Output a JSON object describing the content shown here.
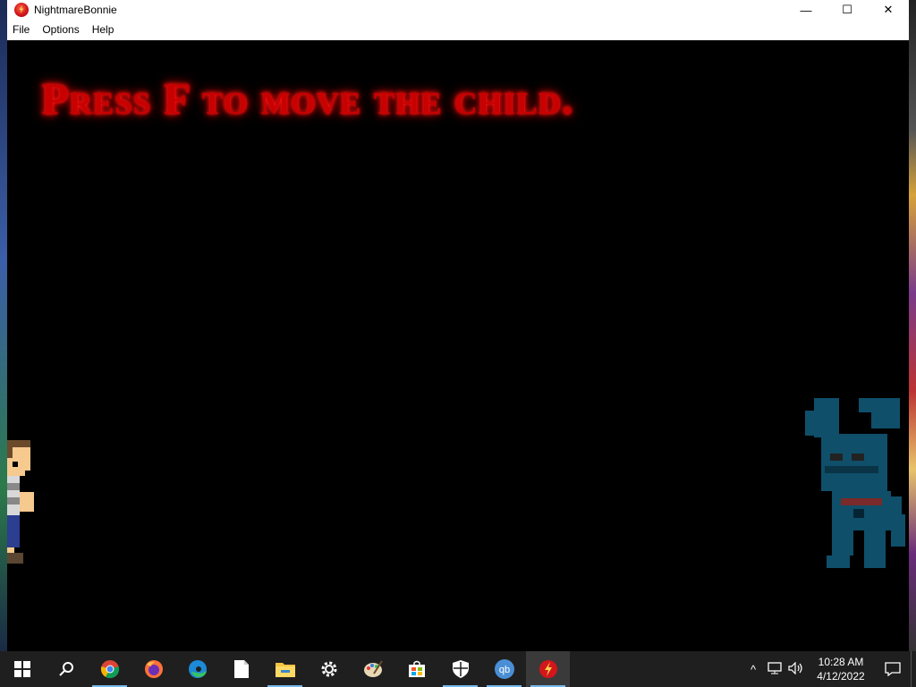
{
  "window": {
    "title": "NightmareBonnie",
    "minimize_glyph": "—",
    "maximize_glyph": "☐",
    "close_glyph": "✕"
  },
  "menu": {
    "file": "File",
    "options": "Options",
    "help": "Help"
  },
  "game": {
    "prompt": "Press F to move the child.",
    "prompt_color": "#c80000",
    "background_color": "#000000",
    "characters": [
      "child-sprite",
      "nightmare-bonnie-sprite"
    ]
  },
  "taskbar": {
    "apps": [
      {
        "name": "start-icon",
        "running": false
      },
      {
        "name": "search-icon",
        "running": false
      },
      {
        "name": "chrome-icon",
        "running": true
      },
      {
        "name": "firefox-icon",
        "running": false
      },
      {
        "name": "edge-icon",
        "running": false
      },
      {
        "name": "notepad-icon",
        "running": false
      },
      {
        "name": "file-explorer-icon",
        "running": true
      },
      {
        "name": "settings-icon",
        "running": false
      },
      {
        "name": "paint-icon",
        "running": false
      },
      {
        "name": "store-icon",
        "running": false
      },
      {
        "name": "security-icon",
        "running": true
      },
      {
        "name": "qbittorrent-icon",
        "running": true
      },
      {
        "name": "nightmarebonnie-app-icon",
        "running": true,
        "active": true
      }
    ],
    "qb_label": "qb",
    "time": "10:28 AM",
    "date": "4/12/2022"
  }
}
